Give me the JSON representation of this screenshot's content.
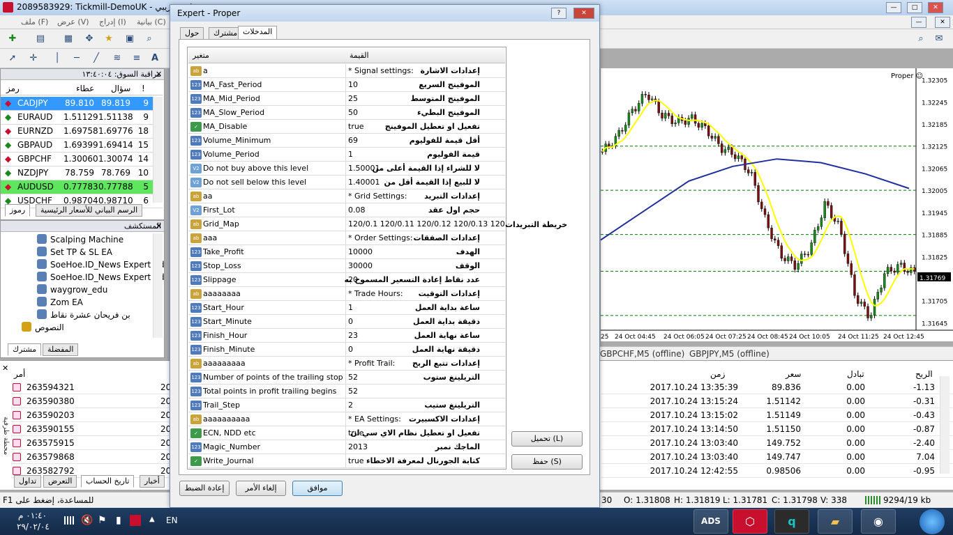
{
  "main_window": {
    "title": "2089583929: Tickmill-DemoUK - حساب تجريبي",
    "menu": [
      "ملف (F)",
      "عرض (V)",
      "إدراج (I)",
      "بيانية (C)"
    ]
  },
  "market_watch": {
    "header": "مراقبة السوق: ١٣:٤٠:٠٤",
    "columns": [
      "رمز",
      "عطاء",
      "سؤال",
      "!"
    ],
    "rows": [
      {
        "symbol": "CADJPY",
        "bid": "89.810",
        "ask": "89.819",
        "spread": "9"
      },
      {
        "symbol": "EURAUD",
        "bid": "1.51129",
        "ask": "1.51138",
        "spread": "9"
      },
      {
        "symbol": "EURNZD",
        "bid": "1.69758",
        "ask": "1.69776",
        "spread": "18"
      },
      {
        "symbol": "GBPAUD",
        "bid": "1.69399",
        "ask": "1.69414",
        "spread": "15"
      },
      {
        "symbol": "GBPCHF",
        "bid": "1.30060",
        "ask": "1.30074",
        "spread": "14"
      },
      {
        "symbol": "NZDJPY",
        "bid": "78.759",
        "ask": "78.769",
        "spread": "10"
      },
      {
        "symbol": "AUDUSD",
        "bid": "0.77783",
        "ask": "0.77788",
        "spread": "5"
      },
      {
        "symbol": "USDCHF",
        "bid": "0.98704",
        "ask": "0.98710",
        "spread": "6"
      }
    ],
    "tabs": [
      "رموز",
      "الرسم البياني للأسعار الرئيسية"
    ]
  },
  "navigator": {
    "header": "المستكشف",
    "items": [
      "Scalping Machine",
      "Set TP & SL EA",
      "SoeHoe.ID_News Expert Ad",
      "SoeHoe.ID_News Expert Ad",
      "waygrow_edu",
      "Zom EA",
      "بن فريحان عشرة نقاط",
      "النصوص"
    ],
    "tabs": [
      "مشترك",
      "المفضلة"
    ]
  },
  "terminal": {
    "side_label": "محطة طرفية",
    "column_order": "أمر",
    "orders": [
      "263594321",
      "263590380",
      "263590203",
      "263590155",
      "263575915",
      "263579868",
      "263582792"
    ],
    "order_col2": [
      "20",
      "20",
      "20",
      "20",
      "20",
      "20",
      "20"
    ],
    "tabs": [
      "تداول",
      "التعرض",
      "تاريخ الحساب",
      "أخبار"
    ],
    "right_columns": {
      "time": "زمن",
      "price": "سعر",
      "swap": "تبادل",
      "profit": "الربح"
    },
    "rows": [
      {
        "time": "2017.10.24 13:35:39",
        "price": "89.836",
        "swap": "0.00",
        "profit": "-1.13"
      },
      {
        "time": "2017.10.24 13:15:24",
        "price": "1.51142",
        "swap": "0.00",
        "profit": "-0.31"
      },
      {
        "time": "2017.10.24 13:15:02",
        "price": "1.51149",
        "swap": "0.00",
        "profit": "-0.43"
      },
      {
        "time": "2017.10.24 13:14:50",
        "price": "1.51150",
        "swap": "0.00",
        "profit": "-0.87"
      },
      {
        "time": "2017.10.24 13:03:40",
        "price": "149.752",
        "swap": "0.00",
        "profit": "-2.40"
      },
      {
        "time": "2017.10.24 13:03:40",
        "price": "149.747",
        "swap": "0.00",
        "profit": "7.04"
      },
      {
        "time": "2017.10.24 12:42:55",
        "price": "0.98506",
        "swap": "0.00",
        "profit": "-0.95"
      }
    ]
  },
  "chart": {
    "ea_label": "Proper ☺",
    "price_labels": [
      "1.32305",
      "1.32245",
      "1.32185",
      "1.32125",
      "1.32065",
      "1.32005",
      "1.31945",
      "1.31885",
      "1.31825",
      "1.31769",
      "1.31705",
      "1.31645"
    ],
    "current_price": "1.31769",
    "time_labels": [
      "25",
      "24 Oct 04:45",
      "24 Oct 06:05",
      "24 Oct 07:25",
      "24 Oct 08:45",
      "24 Oct 10:05",
      "24 Oct 11:25",
      "24 Oct 12:45"
    ],
    "chart_tabs": [
      "GBPCHF,M5 (offline)",
      "GBPJPY,M5 (offline)"
    ]
  },
  "status_bar": {
    "help": "للمساعدة، إضغط على F1",
    "time": "30",
    "open": "O: 1.31808",
    "high": "H: 1.31819",
    "low": "L: 1.31781",
    "close": "C: 1.31798",
    "volume": "V: 338",
    "traffic": "9294/19 kb"
  },
  "dialog": {
    "title": "Expert - Proper",
    "tabs": [
      "حول",
      "مشترك",
      "المدخلات"
    ],
    "col_variable": "متغير",
    "col_value": "القيمة",
    "params": [
      {
        "icon": "ab",
        "name": "a",
        "value": "* Signal settings:",
        "comment": "إعدادات الاشارة"
      },
      {
        "icon": "123",
        "name": "MA_Fast_Period",
        "value": "10",
        "comment": "الموفينج السريع"
      },
      {
        "icon": "123",
        "name": "MA_Mid_Period",
        "value": "25",
        "comment": "الموفينج المتوسط"
      },
      {
        "icon": "123",
        "name": "MA_Slow_Period",
        "value": "50",
        "comment": "الموفينج البطيء"
      },
      {
        "icon": "bool",
        "name": "MA_Disable",
        "value": "true",
        "comment": "تفعيل او تعطيل الموفينج"
      },
      {
        "icon": "123",
        "name": "Volume_Minimum",
        "value": "69",
        "comment": "أقل قيمة للفوليوم"
      },
      {
        "icon": "123",
        "name": "Volume_Period",
        "value": "1",
        "comment": "قيمة الفوليوم"
      },
      {
        "icon": "v2",
        "name": "Do not buy above this level",
        "value": "1.50001",
        "comment": "لا للشراء إذا القيمة أعلى من"
      },
      {
        "icon": "v2",
        "name": "Do not sell below this level",
        "value": "1.40001",
        "comment": "لا للبيع إذا القيمة أقل من"
      },
      {
        "icon": "ab",
        "name": "aa",
        "value": "* Grid Settings:",
        "comment": "إعدادات التبريد"
      },
      {
        "icon": "v2",
        "name": "First_Lot",
        "value": "0.08",
        "comment": "حجم اول عقد"
      },
      {
        "icon": "ab",
        "name": "Grid_Map",
        "value": "120/0.1 120/0.11 120/0.12 120/0.13 120/0...",
        "comment": ""
      },
      {
        "icon": "ab",
        "name": "aaa",
        "value": "* Order Settings:",
        "comment": "إعدادات الصفقات"
      },
      {
        "icon": "123",
        "name": "Take_Profit",
        "value": "10000",
        "comment": "الهدف"
      },
      {
        "icon": "123",
        "name": "Stop_Loss",
        "value": "30000",
        "comment": "الوقف"
      },
      {
        "icon": "123",
        "name": "Slippage",
        "value": "20",
        "comment": "عدد نقاط إعادة التسعير المسموح به"
      },
      {
        "icon": "ab",
        "name": "aaaaaaaa",
        "value": "* Trade Hours:",
        "comment": "إعدادات التوقيت"
      },
      {
        "icon": "123",
        "name": "Start_Hour",
        "value": "1",
        "comment": "ساعة بداية العمل"
      },
      {
        "icon": "123",
        "name": "Start_Minute",
        "value": "0",
        "comment": "دقيقة بداية العمل"
      },
      {
        "icon": "123",
        "name": "Finish_Hour",
        "value": "23",
        "comment": "ساعة نهاية العمل"
      },
      {
        "icon": "123",
        "name": "Finish_Minute",
        "value": "0",
        "comment": "دقيقة نهاية العمل"
      },
      {
        "icon": "ab",
        "name": "aaaaaaaaa",
        "value": "* Profit Trail:",
        "comment": "إعدادات تتبع الربح"
      },
      {
        "icon": "123",
        "name": "Number of points of the trailing stop",
        "value": "52",
        "comment": "التريلينغ ستوب"
      },
      {
        "icon": "123",
        "name": "Total points in profit trailing begins",
        "value": "52",
        "comment": ""
      },
      {
        "icon": "123",
        "name": "Trail_Step",
        "value": "2",
        "comment": "التريلينغ ستيب"
      },
      {
        "icon": "ab",
        "name": "aaaaaaaaaa",
        "value": "* EA Settings:",
        "comment": "إعدادات الاكسبيرت"
      },
      {
        "icon": "bool",
        "name": "ECN, NDD etc",
        "value": "true",
        "comment": "تفعيل او تعطيل نظام الاي سي ان"
      },
      {
        "icon": "123",
        "name": "Magic_Number",
        "value": "2013",
        "comment": "الماجك نمبر"
      },
      {
        "icon": "bool",
        "name": "Write_Journal",
        "value": "true",
        "comment": "كتابة الجورنال لمعرفة الاخطاء"
      }
    ],
    "outside_label": "خريطة التبريدات",
    "load_button": "تحميل (L)",
    "save_button": "حفظ (S)",
    "ok_button": "موافق",
    "cancel_button": "إلغاء الأمر",
    "reset_button": "إعادة الضبط"
  },
  "taskbar": {
    "lang": "EN",
    "clock_time": "٠١:٤٠ م",
    "clock_date": "٢٩/٠٢/٠٤"
  },
  "colors": {
    "selected_row": "#3399ff",
    "green_row": "#5ee65e",
    "chart_yellow": "#ffff00",
    "chart_blue": "#1f2f9f",
    "grid_green": "#007a00"
  }
}
